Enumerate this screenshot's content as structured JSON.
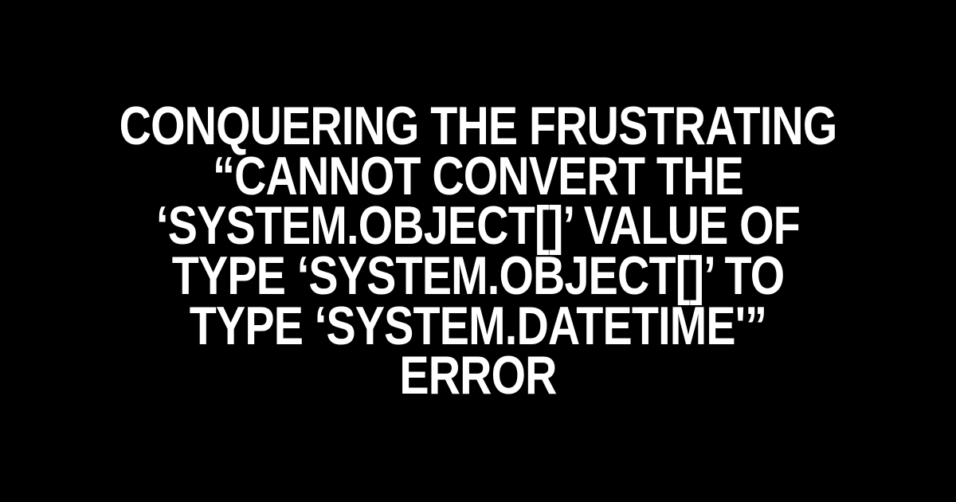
{
  "title": "CONQUERING THE FRUSTRATING “CANNOT CONVERT THE ‘SYSTEM.OBJECT[]’ VALUE OF TYPE ‘SYSTEM.OBJECT[]’ TO TYPE ‘SYSTEM.DATETIME'” ERROR"
}
